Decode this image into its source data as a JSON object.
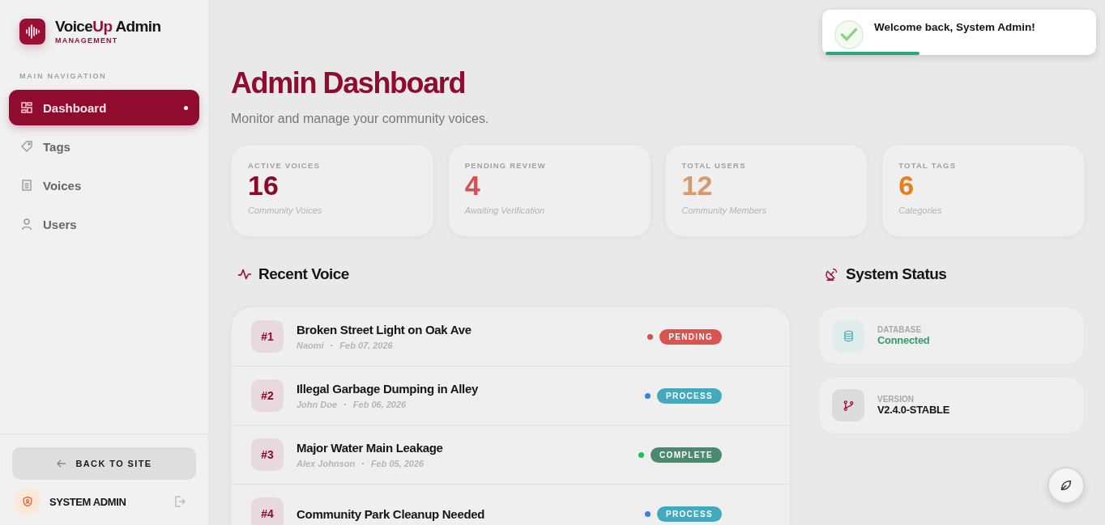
{
  "brand": {
    "name_parts": [
      {
        "text": "Voice",
        "accent": false
      },
      {
        "text": "Up",
        "accent": true
      },
      {
        "text": " Admin",
        "accent": false
      }
    ],
    "subtitle": "MANAGEMENT"
  },
  "sidebar": {
    "section_label": "MAIN NAVIGATION",
    "items": [
      {
        "label": "Dashboard",
        "selected": true
      },
      {
        "label": "Tags",
        "selected": false
      },
      {
        "label": "Voices",
        "selected": false
      },
      {
        "label": "Users",
        "selected": false
      }
    ],
    "back_button": "BACK TO SITE",
    "user_name": "SYSTEM ADMIN"
  },
  "page": {
    "title": "Admin Dashboard",
    "subtitle": "Monitor and manage your community voices."
  },
  "stats": [
    {
      "label": "ACTIVE VOICES",
      "value": "16",
      "caption": "Community Voices",
      "color": "#8b0a2a"
    },
    {
      "label": "PENDING REVIEW",
      "value": "4",
      "caption": "Awaiting Verification",
      "color": "#d65050"
    },
    {
      "label": "TOTAL USERS",
      "value": "12",
      "caption": "Community Members",
      "color": "#d99868"
    },
    {
      "label": "TOTAL TAGS",
      "value": "6",
      "caption": "Categories",
      "color": "#e67e1a"
    }
  ],
  "recent": {
    "title": "Recent Voice",
    "rows": [
      {
        "number": "#1",
        "title": "Broken Street Light on Oak Ave",
        "author": "Naomi",
        "separator": "·",
        "date": "Feb 07, 2026",
        "status": "PENDING",
        "kind": "pending",
        "color": "#d65050"
      },
      {
        "number": "#2",
        "title": "Illegal Garbage Dumping in Alley",
        "author": "John Doe",
        "separator": "·",
        "date": "Feb 06, 2026",
        "status": "PROCESS",
        "kind": "process",
        "color": "#3b82e0"
      },
      {
        "number": "#3",
        "title": "Major Water Main Leakage",
        "author": "Alex Johnson",
        "separator": "·",
        "date": "Feb 05, 2026",
        "status": "COMPLETE",
        "kind": "complete",
        "color": "#18c45a"
      },
      {
        "number": "#4",
        "title": "Community Park Cleanup Needed",
        "status": "PROCESS",
        "kind": "process",
        "color": "#3b82e0"
      }
    ]
  },
  "system_status": {
    "title": "System Status",
    "items": [
      {
        "kind": "database",
        "label": "DATABASE",
        "value": "Connected"
      },
      {
        "kind": "version",
        "label": "VERSION",
        "value": "V2.4.0-STABLE"
      }
    ]
  },
  "toast": {
    "message": "Welcome back, System Admin!",
    "level": 0.35
  }
}
